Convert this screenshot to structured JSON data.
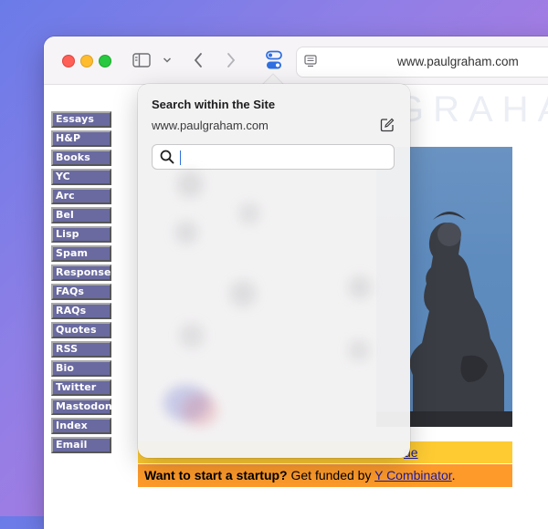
{
  "browser": {
    "url": "www.paulgraham.com"
  },
  "site": {
    "title_fragment": "GRAHAM",
    "nav": [
      "Essays",
      "H&P",
      "Books",
      "YC",
      "Arc",
      "Bel",
      "Lisp",
      "Spam",
      "Responses",
      "FAQs",
      "RAQs",
      "Quotes",
      "RSS",
      "Bio",
      "Twitter",
      "Mastodon",
      "Index",
      "Email"
    ],
    "banner1_link": "de",
    "banner2_bold": "Want to start a startup?",
    "banner2_text": " Get funded by ",
    "banner2_link": "Y Combinator",
    "banner2_end": "."
  },
  "popup": {
    "title": "Search within the Site",
    "domain": "www.paulgraham.com",
    "search_value": "",
    "search_placeholder": ""
  },
  "colors": {
    "nav_button": "#6a6aa0",
    "banner_yellow": "#fecb33",
    "banner_orange": "#fd9a2a",
    "toggle_blue": "#2f6fe0"
  }
}
